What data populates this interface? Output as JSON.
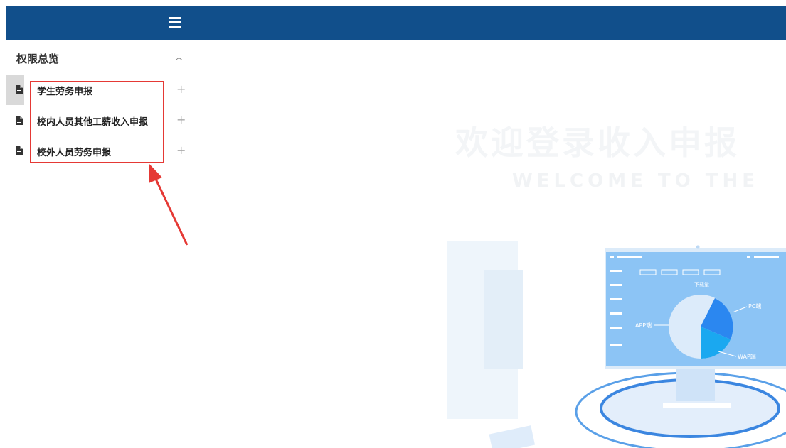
{
  "header": {
    "menu_icon": "hamburger-icon",
    "bg_color": "#114f8b"
  },
  "sidebar": {
    "group": {
      "title": "权限总览",
      "toggle_icon": "chevron-up-icon"
    },
    "items": [
      {
        "label": "学生劳务申报",
        "icon": "file-icon",
        "action_icon": "plus-icon"
      },
      {
        "label": "校内人员其他工薪收入申报",
        "icon": "file-icon",
        "action_icon": "plus-icon"
      },
      {
        "label": "校外人员劳务申报",
        "icon": "file-icon",
        "action_icon": "plus-icon"
      }
    ]
  },
  "annotation": {
    "box_color": "#e53935"
  },
  "illustration": {
    "chart_labels": {
      "center": "下载量",
      "pc": "PC端",
      "app": "APP端",
      "wap": "WAP端"
    }
  }
}
